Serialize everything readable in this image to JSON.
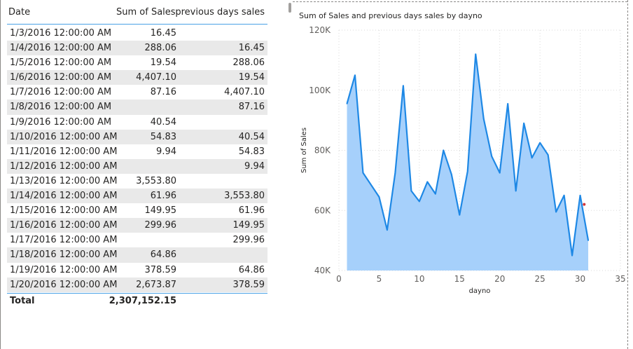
{
  "table": {
    "headers": {
      "date": "Date",
      "sales": "Sum of Sales",
      "prev": "previous days sales"
    },
    "rows": [
      {
        "date": "1/3/2016 12:00:00 AM",
        "sales": "16.45",
        "prev": ""
      },
      {
        "date": "1/4/2016 12:00:00 AM",
        "sales": "288.06",
        "prev": "16.45"
      },
      {
        "date": "1/5/2016 12:00:00 AM",
        "sales": "19.54",
        "prev": "288.06"
      },
      {
        "date": "1/6/2016 12:00:00 AM",
        "sales": "4,407.10",
        "prev": "19.54"
      },
      {
        "date": "1/7/2016 12:00:00 AM",
        "sales": "87.16",
        "prev": "4,407.10"
      },
      {
        "date": "1/8/2016 12:00:00 AM",
        "sales": "",
        "prev": "87.16"
      },
      {
        "date": "1/9/2016 12:00:00 AM",
        "sales": "40.54",
        "prev": ""
      },
      {
        "date": "1/10/2016 12:00:00 AM",
        "sales": "54.83",
        "prev": "40.54"
      },
      {
        "date": "1/11/2016 12:00:00 AM",
        "sales": "9.94",
        "prev": "54.83"
      },
      {
        "date": "1/12/2016 12:00:00 AM",
        "sales": "",
        "prev": "9.94"
      },
      {
        "date": "1/13/2016 12:00:00 AM",
        "sales": "3,553.80",
        "prev": ""
      },
      {
        "date": "1/14/2016 12:00:00 AM",
        "sales": "61.96",
        "prev": "3,553.80"
      },
      {
        "date": "1/15/2016 12:00:00 AM",
        "sales": "149.95",
        "prev": "61.96"
      },
      {
        "date": "1/16/2016 12:00:00 AM",
        "sales": "299.96",
        "prev": "149.95"
      },
      {
        "date": "1/17/2016 12:00:00 AM",
        "sales": "",
        "prev": "299.96"
      },
      {
        "date": "1/18/2016 12:00:00 AM",
        "sales": "64.86",
        "prev": ""
      },
      {
        "date": "1/19/2016 12:00:00 AM",
        "sales": "378.59",
        "prev": "64.86"
      },
      {
        "date": "1/20/2016 12:00:00 AM",
        "sales": "2,673.87",
        "prev": "378.59"
      }
    ],
    "total": {
      "label": "Total",
      "sales": "2,307,152.15"
    }
  },
  "colors": {
    "area_fill": "#a6d0fb",
    "line": "#1e88e5",
    "header_rule": "#4aa2e6",
    "marker": "#d13438"
  },
  "chart_data": {
    "type": "area",
    "title": "Sum of Sales and previous days sales by dayno",
    "xlabel": "dayno",
    "ylabel": "Sum of Sales",
    "xlim": [
      0,
      35
    ],
    "ylim": [
      40000,
      120000
    ],
    "x_ticks": [
      0,
      5,
      10,
      15,
      20,
      25,
      30,
      35
    ],
    "y_ticks": [
      40000,
      60000,
      80000,
      100000,
      120000
    ],
    "y_tick_labels": [
      "40K",
      "60K",
      "80K",
      "100K",
      "120K"
    ],
    "grid": true,
    "series": [
      {
        "x": [
          1,
          2,
          3,
          4,
          5,
          6,
          7,
          8,
          9,
          10,
          11,
          12,
          13,
          14,
          15,
          16,
          17,
          18,
          19,
          20,
          21,
          22,
          23,
          24,
          25,
          26,
          27,
          28,
          29,
          30,
          31
        ],
        "values": [
          95500,
          105000,
          72500,
          68500,
          64500,
          53500,
          72500,
          101500,
          66500,
          63000,
          69500,
          65500,
          80000,
          72000,
          58500,
          73000,
          112000,
          90500,
          78000,
          72500,
          95500,
          66500,
          89000,
          77500,
          82500,
          78500,
          59500,
          65000,
          45000,
          65000,
          50000
        ]
      },
      {
        "x": [
          30.5
        ],
        "values": [
          62000
        ]
      }
    ]
  }
}
